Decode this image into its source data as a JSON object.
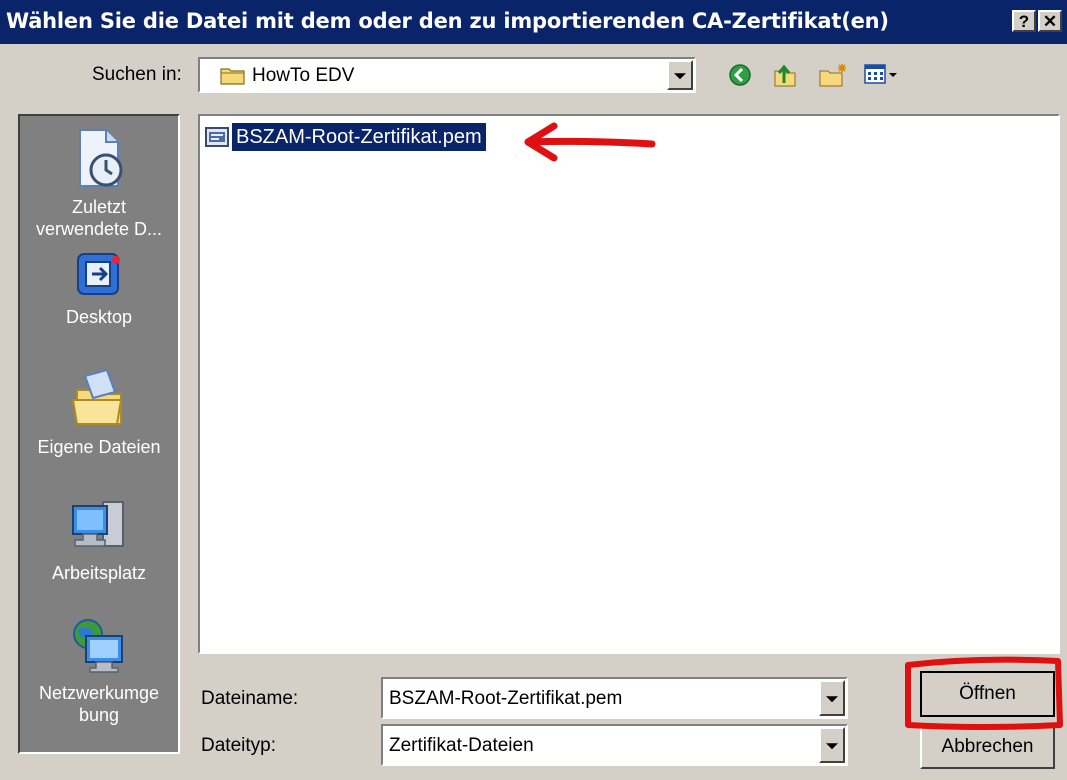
{
  "dialog": {
    "title": "Wählen Sie die Datei mit dem oder den zu importierenden CA-Zertifikat(en)",
    "help_button": "?",
    "close_button": "✕"
  },
  "look_in": {
    "label": "Suchen in:",
    "value": "HowTo EDV"
  },
  "toolbar": {
    "icons": [
      "back-icon",
      "up-folder-icon",
      "new-folder-icon",
      "view-menu-icon"
    ]
  },
  "places": [
    {
      "label_line1": "Zuletzt",
      "label_line2": "verwendete D...",
      "icon": "recent-documents-icon"
    },
    {
      "label_line1": "Desktop",
      "label_line2": "",
      "icon": "desktop-icon"
    },
    {
      "label_line1": "Eigene Dateien",
      "label_line2": "",
      "icon": "my-documents-icon"
    },
    {
      "label_line1": "Arbeitsplatz",
      "label_line2": "",
      "icon": "my-computer-icon"
    },
    {
      "label_line1": "Netzwerkumge",
      "label_line2": "bung",
      "icon": "network-icon"
    }
  ],
  "files": [
    {
      "name": "BSZAM-Root-Zertifikat.pem",
      "selected": true,
      "icon": "certificate-file-icon"
    }
  ],
  "filename": {
    "label": "Dateiname:",
    "value": "BSZAM-Root-Zertifikat.pem"
  },
  "filetype": {
    "label": "Dateityp:",
    "value": "Zertifikat-Dateien"
  },
  "buttons": {
    "open": "Öffnen",
    "cancel": "Abbrechen"
  },
  "colors": {
    "titlebar": "#0a246a",
    "dialog_bg": "#d4d0c8",
    "selection": "#0a246a",
    "annotation": "#e01010"
  }
}
